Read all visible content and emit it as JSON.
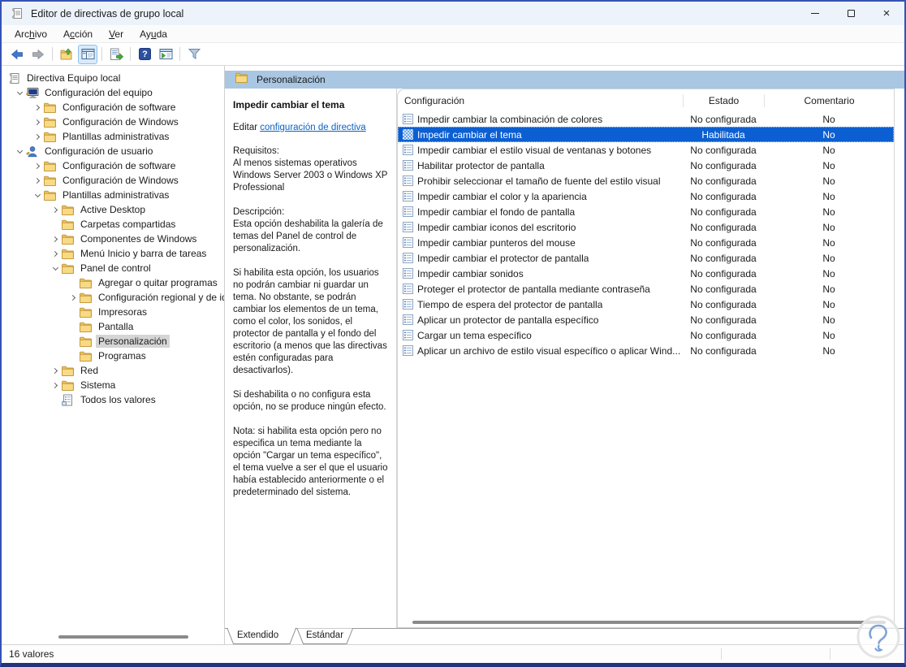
{
  "window": {
    "title": "Editor de directivas de grupo local",
    "controls": [
      {
        "name": "minimize-button",
        "glyph": "minimize"
      },
      {
        "name": "maximize-button",
        "glyph": "maximize"
      },
      {
        "name": "close-button",
        "glyph": "close"
      }
    ]
  },
  "menu": {
    "items": [
      {
        "pre": "Arc",
        "key": "h",
        "post": "ivo"
      },
      {
        "pre": "A",
        "key": "c",
        "post": "ción"
      },
      {
        "pre": "",
        "key": "V",
        "post": "er"
      },
      {
        "pre": "Ay",
        "key": "u",
        "post": "da"
      }
    ]
  },
  "toolbar": {
    "buttons": [
      {
        "type": "button",
        "icon": "back-arrow",
        "active": false
      },
      {
        "type": "button",
        "icon": "forward-arrow",
        "active": false
      },
      {
        "type": "sep"
      },
      {
        "type": "button",
        "icon": "up-folder",
        "active": false
      },
      {
        "type": "button",
        "icon": "console-tree",
        "active": true
      },
      {
        "type": "sep"
      },
      {
        "type": "button",
        "icon": "export-list",
        "active": false
      },
      {
        "type": "sep"
      },
      {
        "type": "button",
        "icon": "help",
        "active": false
      },
      {
        "type": "button",
        "icon": "show-window",
        "active": false
      },
      {
        "type": "sep"
      },
      {
        "type": "button",
        "icon": "filter",
        "active": false
      }
    ]
  },
  "tree": {
    "items": [
      {
        "label": "Directiva Equipo local",
        "depth": 0,
        "icon": "scroll",
        "chevron": "none",
        "selected": false
      },
      {
        "label": "Configuración del equipo",
        "depth": 1,
        "icon": "computer",
        "chevron": "expanded",
        "selected": false
      },
      {
        "label": "Configuración de software",
        "depth": 2,
        "icon": "folder",
        "chevron": "collapsed",
        "selected": false
      },
      {
        "label": "Configuración de Windows",
        "depth": 2,
        "icon": "folder",
        "chevron": "collapsed",
        "selected": false
      },
      {
        "label": "Plantillas administrativas",
        "depth": 2,
        "icon": "folder",
        "chevron": "collapsed",
        "selected": false
      },
      {
        "label": "Configuración de usuario",
        "depth": 1,
        "icon": "user",
        "chevron": "expanded",
        "selected": false
      },
      {
        "label": "Configuración de software",
        "depth": 2,
        "icon": "folder",
        "chevron": "collapsed",
        "selected": false
      },
      {
        "label": "Configuración de Windows",
        "depth": 2,
        "icon": "folder",
        "chevron": "collapsed",
        "selected": false
      },
      {
        "label": "Plantillas administrativas",
        "depth": 2,
        "icon": "folder",
        "chevron": "expanded",
        "selected": false
      },
      {
        "label": "Active Desktop",
        "depth": 3,
        "icon": "folder",
        "chevron": "collapsed",
        "selected": false
      },
      {
        "label": "Carpetas compartidas",
        "depth": 3,
        "icon": "folder",
        "chevron": "none",
        "selected": false
      },
      {
        "label": "Componentes de Windows",
        "depth": 3,
        "icon": "folder",
        "chevron": "collapsed",
        "selected": false
      },
      {
        "label": "Menú Inicio y barra de tareas",
        "depth": 3,
        "icon": "folder",
        "chevron": "collapsed",
        "selected": false
      },
      {
        "label": "Panel de control",
        "depth": 3,
        "icon": "folder",
        "chevron": "expanded",
        "selected": false
      },
      {
        "label": "Agregar o quitar programas",
        "depth": 4,
        "icon": "folder",
        "chevron": "none",
        "selected": false
      },
      {
        "label": "Configuración regional y de idioma",
        "depth": 4,
        "icon": "folder",
        "chevron": "collapsed",
        "selected": false
      },
      {
        "label": "Impresoras",
        "depth": 4,
        "icon": "folder",
        "chevron": "none",
        "selected": false
      },
      {
        "label": "Pantalla",
        "depth": 4,
        "icon": "folder",
        "chevron": "none",
        "selected": false
      },
      {
        "label": "Personalización",
        "depth": 4,
        "icon": "folder",
        "chevron": "none",
        "selected": true
      },
      {
        "label": "Programas",
        "depth": 4,
        "icon": "folder",
        "chevron": "none",
        "selected": false
      },
      {
        "label": "Red",
        "depth": 3,
        "icon": "folder",
        "chevron": "collapsed",
        "selected": false
      },
      {
        "label": "Sistema",
        "depth": 3,
        "icon": "folder",
        "chevron": "collapsed",
        "selected": false
      },
      {
        "label": "Todos los valores",
        "depth": 3,
        "icon": "all-values",
        "chevron": "none",
        "selected": false
      }
    ]
  },
  "result_header": {
    "title": "Personalización",
    "icon": "folder"
  },
  "detail": {
    "policy_title": "Impedir cambiar el tema",
    "edit_prefix": "Editar ",
    "edit_link": "configuración de directiva",
    "paragraphs": [
      "Requisitos:\nAl menos sistemas operativos\nWindows Server 2003 o Windows XP\nProfessional",
      "Descripción:\nEsta opción deshabilita la galería de\ntemas del Panel de control de\npersonalización.",
      "Si habilita esta opción, los usuarios\nno podrán cambiar ni guardar un\ntema.  No obstante, se podrán\ncambiar los elementos de un tema,\ncomo el color, los sonidos, el\nprotector de pantalla y el fondo del\nescritorio (a menos que las directivas\nestén configuradas para\ndesactivarlos).",
      "Si deshabilita o no configura esta\nopción, no se produce ningún efecto.",
      "Nota: si habilita esta opción pero no\nespecifica un tema mediante la\nopción \"Cargar un tema específico\",\nel tema vuelve a ser el que el usuario\nhabía establecido anteriormente o el\npredeterminado del sistema."
    ]
  },
  "list": {
    "columns": [
      {
        "label": "Configuración"
      },
      {
        "label": "Estado"
      },
      {
        "label": "Comentario"
      }
    ],
    "rows": [
      {
        "name": "Impedir cambiar la combinación de colores",
        "estado": "No configurada",
        "comentario": "No",
        "selected": false
      },
      {
        "name": "Impedir cambiar el tema",
        "estado": "Habilitada",
        "comentario": "No",
        "selected": true
      },
      {
        "name": "Impedir cambiar el estilo visual de ventanas y botones",
        "estado": "No configurada",
        "comentario": "No",
        "selected": false
      },
      {
        "name": "Habilitar protector de pantalla",
        "estado": "No configurada",
        "comentario": "No",
        "selected": false
      },
      {
        "name": "Prohibir seleccionar el tamaño de fuente del estilo visual",
        "estado": "No configurada",
        "comentario": "No",
        "selected": false
      },
      {
        "name": "Impedir cambiar el color y la apariencia",
        "estado": "No configurada",
        "comentario": "No",
        "selected": false
      },
      {
        "name": "Impedir cambiar el fondo de pantalla",
        "estado": "No configurada",
        "comentario": "No",
        "selected": false
      },
      {
        "name": "Impedir cambiar iconos del escritorio",
        "estado": "No configurada",
        "comentario": "No",
        "selected": false
      },
      {
        "name": "Impedir cambiar punteros del mouse",
        "estado": "No configurada",
        "comentario": "No",
        "selected": false
      },
      {
        "name": "Impedir cambiar el protector de pantalla",
        "estado": "No configurada",
        "comentario": "No",
        "selected": false
      },
      {
        "name": "Impedir cambiar sonidos",
        "estado": "No configurada",
        "comentario": "No",
        "selected": false
      },
      {
        "name": "Proteger el protector de pantalla mediante contraseña",
        "estado": "No configurada",
        "comentario": "No",
        "selected": false
      },
      {
        "name": "Tiempo de espera del protector de pantalla",
        "estado": "No configurada",
        "comentario": "No",
        "selected": false
      },
      {
        "name": "Aplicar un protector de pantalla específico",
        "estado": "No configurada",
        "comentario": "No",
        "selected": false
      },
      {
        "name": "Cargar un tema específico",
        "estado": "No configurada",
        "comentario": "No",
        "selected": false
      },
      {
        "name": "Aplicar un archivo de estilo visual específico o aplicar Wind...",
        "estado": "No configurada",
        "comentario": "No",
        "selected": false
      }
    ]
  },
  "tabs": {
    "items": [
      {
        "label": "Extendido",
        "active": true
      },
      {
        "label": "Estándar",
        "active": false
      }
    ]
  },
  "statusbar": {
    "text": "16 valores"
  },
  "colors": {
    "selection_blue": "#0b5fd2",
    "header_band": "#a9c6e2",
    "link_blue": "#0a62c3",
    "window_border": "#3552b4",
    "titlebar_bg": "#edf3fb",
    "tree_selection_gray": "#d5d5d5"
  }
}
